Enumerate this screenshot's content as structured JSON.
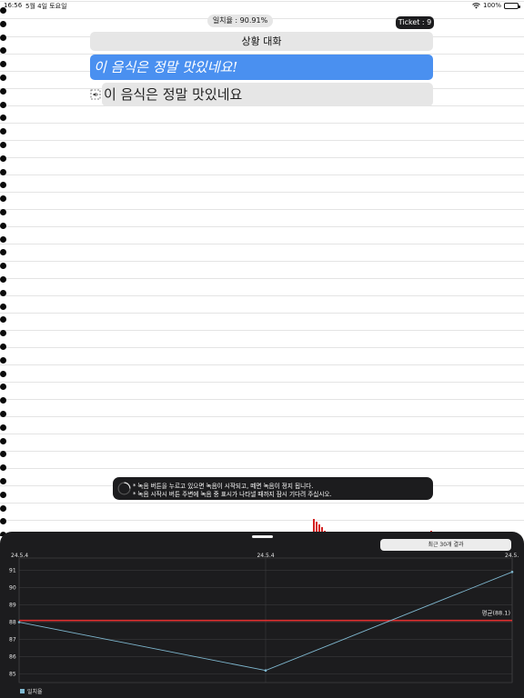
{
  "status_bar": {
    "time": "16:56",
    "date": "5월 4일 토요일",
    "battery": "100%"
  },
  "header": {
    "match_rate": "일치율 : 90.91%",
    "ticket": "Ticket : 9"
  },
  "lesson": {
    "topic": "상황 대화",
    "target_sentence": "이 음식은 정말 맛있네요!",
    "answer": "이 음식은 정말 맛있네요"
  },
  "hint": {
    "line1": "* 녹음 버튼을 누르고 있으면 녹음이 시작되고, 떼면 녹음이 정지 됩니다.",
    "line2": "* 녹음 시작시 버튼 주변에 녹음 중 표시가 나타낼 때까지 잠시 기다려 주십시오."
  },
  "sheet": {
    "recent_button": "최근 30개 결과"
  },
  "colors": {
    "accent_blue": "#4a90f0",
    "sheet_bg": "#1c1c1e",
    "series_line": "#7fb8d0",
    "average_line": "#e03030"
  },
  "chart_data": {
    "type": "line",
    "x_labels": [
      "24.5.4",
      "24.5.4",
      "24.5."
    ],
    "y_ticks": [
      85,
      86,
      87,
      88,
      89,
      90,
      91
    ],
    "ylim": [
      84.5,
      91.4
    ],
    "series": [
      {
        "name": "일치율",
        "values": [
          88.0,
          85.2,
          90.91
        ]
      }
    ],
    "average": {
      "value": 88.1,
      "label": "평균(88.1)"
    },
    "legend": "bottom-left",
    "grid": true
  }
}
